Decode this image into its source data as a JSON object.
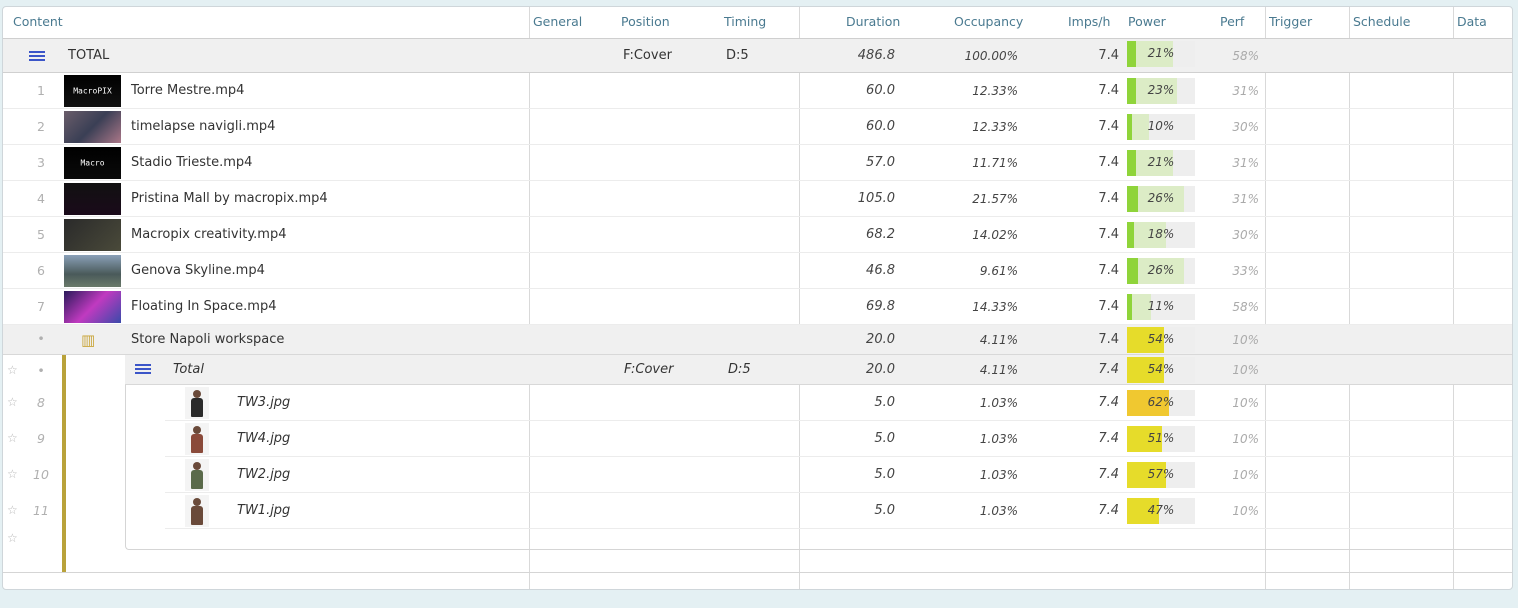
{
  "columns": {
    "content": "Content",
    "general": "General",
    "position": "Position",
    "timing": "Timing",
    "duration": "Duration",
    "occupancy": "Occupancy",
    "imps": "Imps/h",
    "power": "Power",
    "perf": "Perf",
    "trigger": "Trigger",
    "schedule": "Schedule",
    "data": "Data"
  },
  "total": {
    "label": "TOTAL",
    "position": "F:Cover",
    "timing": "D:5",
    "duration": "486.8",
    "occupancy": "100.00%",
    "imps": "7.4",
    "power": 21,
    "power_label": "21%",
    "perf": "58%"
  },
  "items": [
    {
      "num": "1",
      "name": "Torre Mestre.mp4",
      "thumb": "MacroPIX",
      "duration": "60.0",
      "occupancy": "12.33%",
      "imps": "7.4",
      "power": 23,
      "power_label": "23%",
      "perf": "31%"
    },
    {
      "num": "2",
      "name": "timelapse navigli.mp4",
      "thumb": "",
      "duration": "60.0",
      "occupancy": "12.33%",
      "imps": "7.4",
      "power": 10,
      "power_label": "10%",
      "perf": "30%"
    },
    {
      "num": "3",
      "name": "Stadio Trieste.mp4",
      "thumb": "Macro",
      "duration": "57.0",
      "occupancy": "11.71%",
      "imps": "7.4",
      "power": 21,
      "power_label": "21%",
      "perf": "31%"
    },
    {
      "num": "4",
      "name": "Pristina Mall by macropix.mp4",
      "thumb": "",
      "duration": "105.0",
      "occupancy": "21.57%",
      "imps": "7.4",
      "power": 26,
      "power_label": "26%",
      "perf": "31%"
    },
    {
      "num": "5",
      "name": "Macropix creativity.mp4",
      "thumb": "",
      "duration": "68.2",
      "occupancy": "14.02%",
      "imps": "7.4",
      "power": 18,
      "power_label": "18%",
      "perf": "30%"
    },
    {
      "num": "6",
      "name": "Genova Skyline.mp4",
      "thumb": "",
      "duration": "46.8",
      "occupancy": "9.61%",
      "imps": "7.4",
      "power": 26,
      "power_label": "26%",
      "perf": "33%"
    },
    {
      "num": "7",
      "name": "Floating In Space.mp4",
      "thumb": "",
      "duration": "69.8",
      "occupancy": "14.33%",
      "imps": "7.4",
      "power": 11,
      "power_label": "11%",
      "perf": "58%"
    }
  ],
  "workspace": {
    "num": "•",
    "name": "Store Napoli workspace",
    "duration": "20.0",
    "occupancy": "4.11%",
    "imps": "7.4",
    "power": 54,
    "power_label": "54%",
    "perf": "10%",
    "total": {
      "num": "•",
      "label": "Total",
      "position": "F:Cover",
      "timing": "D:5",
      "duration": "20.0",
      "occupancy": "4.11%",
      "imps": "7.4",
      "power": 54,
      "power_label": "54%",
      "perf": "10%"
    },
    "items": [
      {
        "num": "8",
        "name": "TW3.jpg",
        "duration": "5.0",
        "occupancy": "1.03%",
        "imps": "7.4",
        "power": 62,
        "power_label": "62%",
        "perf": "10%"
      },
      {
        "num": "9",
        "name": "TW4.jpg",
        "duration": "5.0",
        "occupancy": "1.03%",
        "imps": "7.4",
        "power": 51,
        "power_label": "51%",
        "perf": "10%"
      },
      {
        "num": "10",
        "name": "TW2.jpg",
        "duration": "5.0",
        "occupancy": "1.03%",
        "imps": "7.4",
        "power": 57,
        "power_label": "57%",
        "perf": "10%"
      },
      {
        "num": "11",
        "name": "TW1.jpg",
        "duration": "5.0",
        "occupancy": "1.03%",
        "imps": "7.4",
        "power": 47,
        "power_label": "47%",
        "perf": "10%"
      }
    ]
  },
  "colors": {
    "power_green": "#8fd43a",
    "power_green_light": "#dcecc6",
    "power_yellow": "#e6dc2a",
    "power_orange": "#f0c830",
    "workspace_accent": "#b9a23a",
    "header_text": "#4a7a90"
  },
  "icons": {
    "total_row": "list-menu-icon",
    "workspace": "workspace-building-icon",
    "favorite": "star-icon"
  }
}
